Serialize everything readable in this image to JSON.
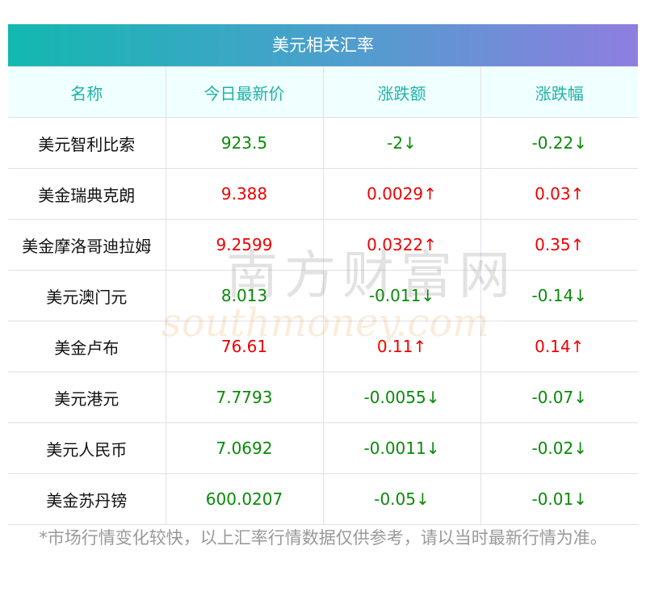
{
  "title": "美元相关汇率",
  "columns": [
    "名称",
    "今日最新价",
    "涨跌额",
    "涨跌幅"
  ],
  "rows": [
    {
      "name": "美元智利比索",
      "price": "923.5",
      "change": "-2↓",
      "pct": "-0.22↓",
      "dir": "down"
    },
    {
      "name": "美金瑞典克朗",
      "price": "9.388",
      "change": "0.0029↑",
      "pct": "0.03↑",
      "dir": "up"
    },
    {
      "name": "美金摩洛哥迪拉姆",
      "price": "9.2599",
      "change": "0.0322↑",
      "pct": "0.35↑",
      "dir": "up"
    },
    {
      "name": "美元澳门元",
      "price": "8.013",
      "change": "-0.011↓",
      "pct": "-0.14↓",
      "dir": "down"
    },
    {
      "name": "美金卢布",
      "price": "76.61",
      "change": "0.11↑",
      "pct": "0.14↑",
      "dir": "up"
    },
    {
      "name": "美元港元",
      "price": "7.7793",
      "change": "-0.0055↓",
      "pct": "-0.07↓",
      "dir": "down"
    },
    {
      "name": "美元人民币",
      "price": "7.0692",
      "change": "-0.0011↓",
      "pct": "-0.02↓",
      "dir": "down"
    },
    {
      "name": "美金苏丹镑",
      "price": "600.0207",
      "change": "-0.05↓",
      "pct": "-0.01↓",
      "dir": "down"
    }
  ],
  "footer": "*市场行情变化较快，以上汇率行情数据仅供参考，请以当时最新行情为准。",
  "watermark": {
    "cn": "南方财富网",
    "en": "southmoney.com"
  },
  "colors": {
    "up": "#ee0000",
    "down": "#0a8a0a",
    "header_text": "#1fb2a8"
  }
}
